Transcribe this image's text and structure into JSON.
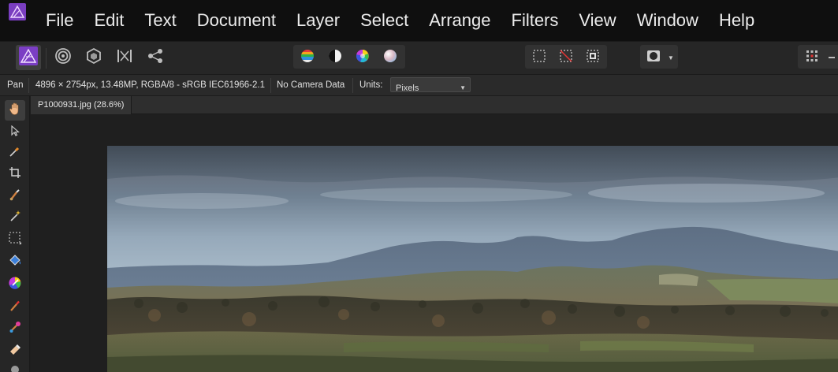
{
  "menu": {
    "items": [
      {
        "label": "File"
      },
      {
        "label": "Edit"
      },
      {
        "label": "Text"
      },
      {
        "label": "Document"
      },
      {
        "label": "Layer"
      },
      {
        "label": "Select"
      },
      {
        "label": "Arrange"
      },
      {
        "label": "Filters"
      },
      {
        "label": "View"
      },
      {
        "label": "Window"
      },
      {
        "label": "Help"
      }
    ]
  },
  "toolbar": {
    "personas": [
      "photo-persona-icon",
      "liquify-persona-icon",
      "develop-persona-icon",
      "tone-mapping-persona-icon",
      "export-persona-icon"
    ],
    "adjustments": [
      "levels-icon",
      "white-balance-icon",
      "hsl-icon",
      "recolor-icon"
    ],
    "selection": [
      "marquee-select-icon",
      "deselect-icon",
      "invert-selection-icon"
    ],
    "mask": [
      "quick-mask-icon"
    ]
  },
  "context": {
    "tool_name": "Pan",
    "image_info": "4896 × 2754px, 13.48MP, RGBA/8 - sRGB IEC61966-2.1",
    "camera_data": "No Camera Data",
    "units_label": "Units:",
    "units_value": "Pixels"
  },
  "document": {
    "tab_title": "P1000931.jpg (28.6%)"
  },
  "colors": {
    "accent_purple": "#6b2fa8",
    "menubar_bg": "#0f0f0f",
    "panel_bg": "#262626"
  }
}
